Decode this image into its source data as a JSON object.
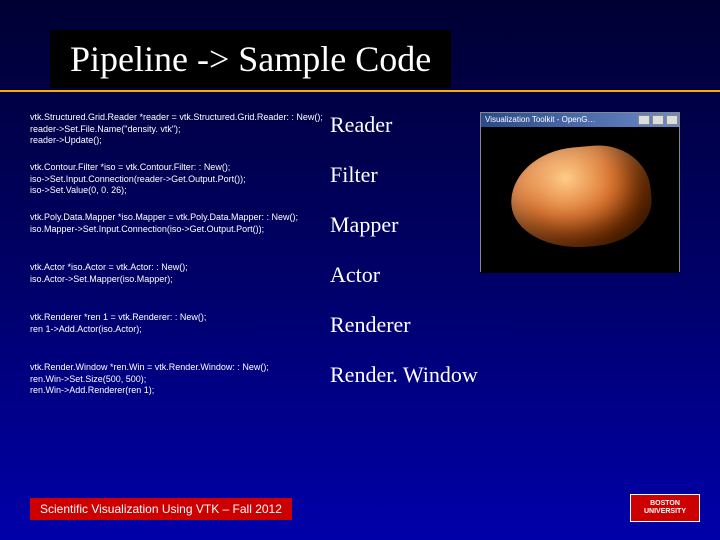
{
  "title": "Pipeline -> Sample Code",
  "rows": [
    {
      "code": "vtk.Structured.Grid.Reader *reader = vtk.Structured.Grid.Reader: : New();\nreader->Set.File.Name(\"density. vtk\");\nreader->Update();",
      "label": "Reader"
    },
    {
      "code": "vtk.Contour.Filter *iso = vtk.Contour.Filter: : New();\niso->Set.Input.Connection(reader->Get.Output.Port());\niso->Set.Value(0, 0. 26);",
      "label": "Filter"
    },
    {
      "code": "vtk.Poly.Data.Mapper *iso.Mapper = vtk.Poly.Data.Mapper: : New();\niso.Mapper->Set.Input.Connection(iso->Get.Output.Port());",
      "label": "Mapper"
    },
    {
      "code": "vtk.Actor *iso.Actor = vtk.Actor: : New();\niso.Actor->Set.Mapper(iso.Mapper);",
      "label": "Actor"
    },
    {
      "code": "vtk.Renderer *ren 1 = vtk.Renderer: : New();\nren 1->Add.Actor(iso.Actor);",
      "label": "Renderer"
    },
    {
      "code": "vtk.Render.Window *ren.Win = vtk.Render.Window: : New();\nren.Win->Set.Size(500, 500);\nren.Win->Add.Renderer(ren 1);",
      "label": "Render. Window"
    }
  ],
  "render_window_title": "Visualization Toolkit - OpenG…",
  "footer": "Scientific Visualization Using VTK – Fall 2012",
  "logo_text": "BOSTON UNIVERSITY"
}
